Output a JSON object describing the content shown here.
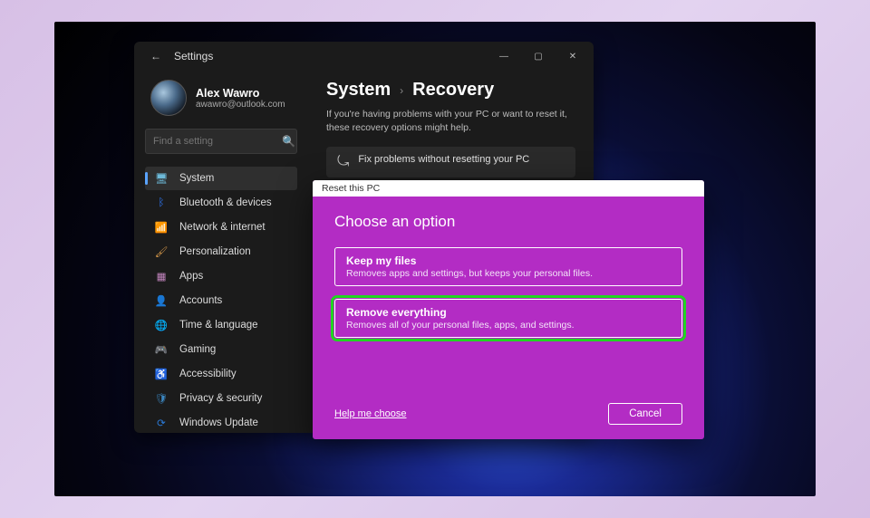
{
  "window": {
    "app_title": "Settings",
    "controls": {
      "min": "—",
      "max": "▢",
      "close": "✕"
    }
  },
  "user": {
    "name": "Alex Wawro",
    "email": "awawro@outlook.com"
  },
  "search": {
    "placeholder": "Find a setting"
  },
  "nav": {
    "items": [
      {
        "label": "System",
        "icon": "🖥"
      },
      {
        "label": "Bluetooth & devices",
        "icon": "ᛒ"
      },
      {
        "label": "Network & internet",
        "icon": "📶"
      },
      {
        "label": "Personalization",
        "icon": "🖌"
      },
      {
        "label": "Apps",
        "icon": "▦"
      },
      {
        "label": "Accounts",
        "icon": "👤"
      },
      {
        "label": "Time & language",
        "icon": "🌐"
      },
      {
        "label": "Gaming",
        "icon": "🎮"
      },
      {
        "label": "Accessibility",
        "icon": "♿"
      },
      {
        "label": "Privacy & security",
        "icon": "🛡"
      },
      {
        "label": "Windows Update",
        "icon": "⟳"
      }
    ]
  },
  "breadcrumb": {
    "root": "System",
    "leaf": "Recovery"
  },
  "page_desc": "If you're having problems with your PC or want to reset it, these recovery options might help.",
  "card1": {
    "title": "Fix problems without resetting your PC"
  },
  "modal": {
    "strip": "Reset this PC",
    "heading": "Choose an option",
    "opt1": {
      "title": "Keep my files",
      "sub": "Removes apps and settings, but keeps your personal files."
    },
    "opt2": {
      "title": "Remove everything",
      "sub": "Removes all of your personal files, apps, and settings."
    },
    "help": "Help me choose",
    "cancel": "Cancel"
  }
}
